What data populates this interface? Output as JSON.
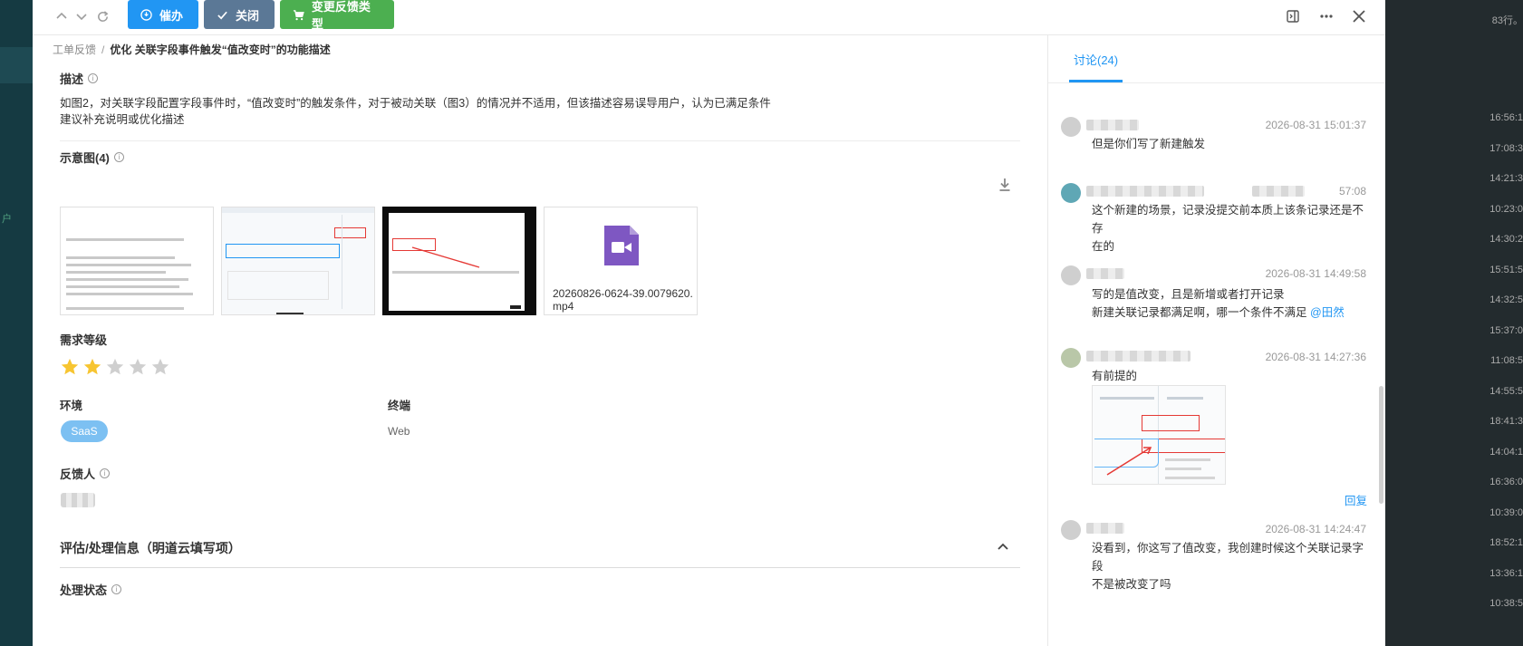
{
  "toolbar": {
    "urge_label": "催办",
    "close_label": "关闭",
    "change_type_label": "变更反馈类型"
  },
  "breadcrumb": {
    "root": "工单反馈",
    "separator": "/",
    "current": "优化 关联字段事件触发“值改变时”的功能描述"
  },
  "description": {
    "title": "描述",
    "line1": "如图2，对关联字段配置字段事件时，“值改变时”的触发条件，对于被动关联（图3）的情况并不适用，但该描述容易误导用户，认为已满足条件",
    "line2": "建议补充说明或优化描述"
  },
  "attachments": {
    "title": "示意图(4)",
    "video_name": "20260826-0624-39.0079620.mp4"
  },
  "priority": {
    "title": "需求等级",
    "rating": 2,
    "max": 5
  },
  "environment": {
    "label": "环境",
    "value": "SaaS"
  },
  "terminal": {
    "label": "终端",
    "value": "Web"
  },
  "feedback_person": {
    "label": "反馈人"
  },
  "assessment": {
    "title": "评估/处理信息（明道云填写项）"
  },
  "status": {
    "title": "处理状态"
  },
  "discussion": {
    "tab_label": "讨论(24)",
    "reply_label": "回复",
    "comments": [
      {
        "time": "2026-08-31 15:01:37",
        "line1": "但是你们写了新建触发",
        "line2": ""
      },
      {
        "time": "57:08",
        "line1": "这个新建的场景，记录没提交前本质上该条记录还是不存",
        "line2": "在的"
      },
      {
        "time": "2026-08-31 14:49:58",
        "line1": "写的是值改变，且是新增或者打开记录",
        "line2": "新建关联记录都满足啊，哪一个条件不满足",
        "mention": "@田然"
      },
      {
        "time": "2026-08-31 14:27:36",
        "line1": "有前提的",
        "line2": ""
      },
      {
        "time": "2026-08-31 14:24:47",
        "line1": "没看到，你这写了值改变，我创建时候这个关联记录字段",
        "line2": "不是被改变了吗"
      }
    ]
  },
  "background": {
    "header_text": "83行。",
    "times": [
      "16:56:1",
      "17:08:3",
      "14:21:3",
      "10:23:0",
      "14:30:2",
      "15:51:5",
      "14:32:5",
      "15:37:0",
      "11:08:5",
      "14:55:5",
      "18:41:3",
      "14:04:1",
      "16:36:0",
      "10:39:0",
      "18:52:1",
      "13:36:1",
      "10:38:5"
    ],
    "left_text": "户"
  },
  "colors": {
    "primary": "#2196f3",
    "close_btn": "#5b7896",
    "change_btn": "#4caf50",
    "star_on": "#f7c531",
    "star_off": "#cfcfcf"
  }
}
